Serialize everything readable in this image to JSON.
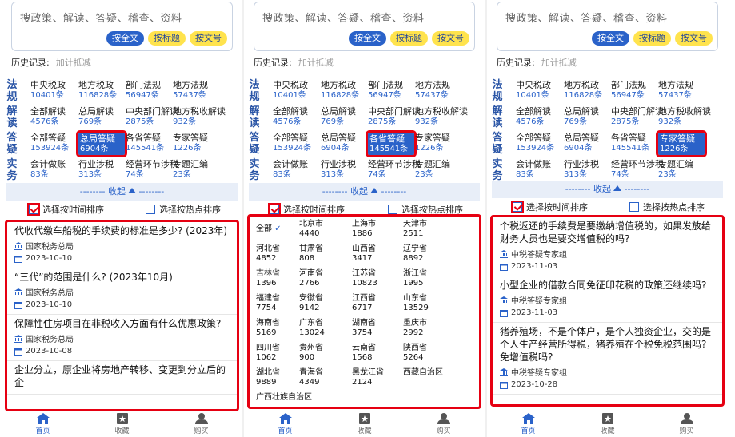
{
  "search": {
    "placeholder": "搜政策、解读、答疑、稽查、资料",
    "btn_full": "按全文",
    "btn_title": "按标题",
    "btn_docno": "按文号"
  },
  "history": {
    "label": "历史记录:",
    "value": "加计抵减"
  },
  "categories": {
    "rows": [
      {
        "side": "法规",
        "items": [
          {
            "name": "中央税政",
            "count": "10401条"
          },
          {
            "name": "地方税政",
            "count": "116828条"
          },
          {
            "name": "部门法规",
            "count": "56947条"
          },
          {
            "name": "地方法规",
            "count": "57437条"
          }
        ]
      },
      {
        "side": "解读",
        "items": [
          {
            "name": "全部解读",
            "count": "4576条"
          },
          {
            "name": "总局解读",
            "count": "769条"
          },
          {
            "name": "中央部门解读",
            "count": "2875条"
          },
          {
            "name": "地方税收解读",
            "count": "932条"
          }
        ]
      },
      {
        "side": "答疑",
        "items": [
          {
            "name": "全部答疑",
            "count": "153924条"
          },
          {
            "name": "总局答疑",
            "count": "6904条"
          },
          {
            "name": "各省答疑",
            "count": "145541条"
          },
          {
            "name": "专家答疑",
            "count": "1226条"
          }
        ]
      },
      {
        "side": "实务",
        "items": [
          {
            "name": "会计做账",
            "count": "83条"
          },
          {
            "name": "行业涉税",
            "count": "313条"
          },
          {
            "name": "经营环节涉税",
            "count": "74条"
          },
          {
            "name": "专题汇编",
            "count": "23条"
          }
        ]
      }
    ]
  },
  "collapse_label": "-------- 收起",
  "collapse_dashes": "--------",
  "sort": {
    "by_time": "选择按时间排序",
    "by_hot": "选择按热点排序"
  },
  "panel1_articles": [
    {
      "title": "代收代缴车船税的手续费的标准是多少? (2023年)",
      "source": "国家税务总局",
      "date": "2023-10-10"
    },
    {
      "title": "“三代”的范围是什么? (2023年10月)",
      "source": "国家税务总局",
      "date": "2023-10-10"
    },
    {
      "title": "保障性住房项目在非税收入方面有什么优惠政策?",
      "source": "国家税务总局",
      "date": "2023-10-08"
    },
    {
      "title": "企业分立，原企业将房地产转移、变更到分立后的企",
      "source": "",
      "date": ""
    }
  ],
  "regions": {
    "all_label": "全部",
    "list": [
      {
        "name": "北京市",
        "count": "4440"
      },
      {
        "name": "上海市",
        "count": "1886"
      },
      {
        "name": "天津市",
        "count": "2511"
      },
      {
        "name": "河北省",
        "count": "4852"
      },
      {
        "name": "甘肃省",
        "count": "808"
      },
      {
        "name": "山西省",
        "count": "3417"
      },
      {
        "name": "辽宁省",
        "count": "8892"
      },
      {
        "name": "吉林省",
        "count": "1396"
      },
      {
        "name": "河南省",
        "count": "2766"
      },
      {
        "name": "江苏省",
        "count": "10823"
      },
      {
        "name": "浙江省",
        "count": "1995"
      },
      {
        "name": "福建省",
        "count": "7754"
      },
      {
        "name": "安徽省",
        "count": "9142"
      },
      {
        "name": "江西省",
        "count": "6717"
      },
      {
        "name": "山东省",
        "count": "13529"
      },
      {
        "name": "海南省",
        "count": "5169"
      },
      {
        "name": "广东省",
        "count": "13024"
      },
      {
        "name": "湖南省",
        "count": "3754"
      },
      {
        "name": "重庆市",
        "count": "2992"
      },
      {
        "name": "四川省",
        "count": "1062"
      },
      {
        "name": "贵州省",
        "count": "900"
      },
      {
        "name": "云南省",
        "count": "1568"
      },
      {
        "name": "陕西省",
        "count": "5264"
      },
      {
        "name": "湖北省",
        "count": "9889"
      },
      {
        "name": "青海省",
        "count": "4349"
      },
      {
        "name": "黑龙江省",
        "count": "2124"
      },
      {
        "name": "西藏自治区",
        "count": ""
      },
      {
        "name": "广西壮族自治区",
        "count": ""
      }
    ]
  },
  "panel3_articles": [
    {
      "title": "个税返还的手续费是要缴纳增值税的，如果发放给财务人员也是要交增值税的吗?",
      "source": "中税答疑专家组",
      "date": "2023-11-03"
    },
    {
      "title": "小型企业的借款合同免征印花税的政策还继续吗?",
      "source": "中税答疑专家组",
      "date": "2023-11-03"
    },
    {
      "title": "猪养殖场，不是个体户，是个人独资企业，交的是个人生产经营所得税，猪养殖在个税免税范围吗? 免增值税吗?",
      "source": "中税答疑专家组",
      "date": "2023-10-28"
    }
  ],
  "nav": {
    "home": "首页",
    "fav": "收藏",
    "buy": "购买"
  },
  "colors": {
    "brand": "#2a62c9",
    "highlight": "#e60012",
    "button_yellow": "#ffe34d"
  }
}
